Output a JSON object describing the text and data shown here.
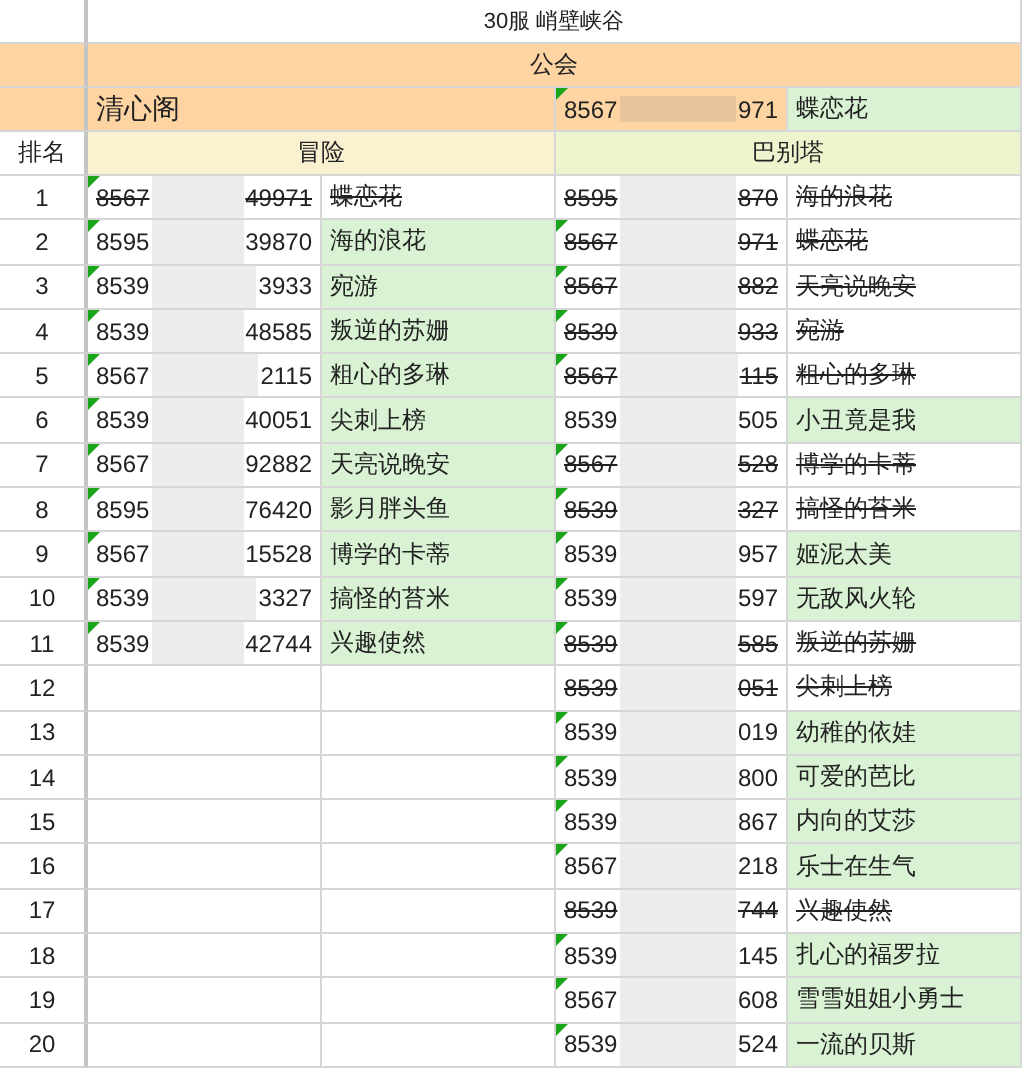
{
  "title": "30服 峭壁峡谷",
  "guild_label": "公会",
  "guild": {
    "name": "清心阁",
    "id_head": "8567",
    "id_tail": "971",
    "flag": true,
    "member": "蝶恋花",
    "struck": false
  },
  "rank_label": "排名",
  "groups": [
    "冒险",
    "巴别塔"
  ],
  "rows": [
    {
      "rank": "1",
      "left": {
        "id_head": "8567",
        "id_tail": "49971",
        "flag": true,
        "name": "蝶恋花",
        "struck": true
      },
      "right": {
        "id_head": "8595",
        "id_tail": "870",
        "flag": false,
        "name": "海的浪花",
        "struck": true
      }
    },
    {
      "rank": "2",
      "left": {
        "id_head": "8595",
        "id_tail": "39870",
        "flag": true,
        "name": "海的浪花",
        "struck": false
      },
      "right": {
        "id_head": "8567",
        "id_tail": "971",
        "flag": true,
        "name": "蝶恋花",
        "struck": true
      }
    },
    {
      "rank": "3",
      "left": {
        "id_head": "8539",
        "id_tail": "3933",
        "flag": true,
        "name": "宛游",
        "struck": false
      },
      "right": {
        "id_head": "8567",
        "id_tail": "882",
        "flag": true,
        "name": "天亮说晚安",
        "struck": true
      }
    },
    {
      "rank": "4",
      "left": {
        "id_head": "8539",
        "id_tail": "48585",
        "flag": true,
        "name": "叛逆的苏姗",
        "struck": false
      },
      "right": {
        "id_head": "8539",
        "id_tail": "933",
        "flag": true,
        "name": "宛游",
        "struck": true
      }
    },
    {
      "rank": "5",
      "left": {
        "id_head": "8567",
        "id_tail": "2115",
        "flag": true,
        "name": "粗心的多琳",
        "struck": false
      },
      "right": {
        "id_head": "8567",
        "id_tail": "115",
        "flag": true,
        "name": "粗心的多琳",
        "struck": true
      }
    },
    {
      "rank": "6",
      "left": {
        "id_head": "8539",
        "id_tail": "40051",
        "flag": true,
        "name": "尖刺上榜",
        "struck": false
      },
      "right": {
        "id_head": "8539",
        "id_tail": "505",
        "flag": false,
        "name": "小丑竟是我",
        "struck": false
      }
    },
    {
      "rank": "7",
      "left": {
        "id_head": "8567",
        "id_tail": "92882",
        "flag": true,
        "name": "天亮说晚安",
        "struck": false
      },
      "right": {
        "id_head": "8567",
        "id_tail": "528",
        "flag": true,
        "name": "博学的卡蒂",
        "struck": true
      }
    },
    {
      "rank": "8",
      "left": {
        "id_head": "8595",
        "id_tail": "76420",
        "flag": true,
        "name": "影月胖头鱼",
        "struck": false
      },
      "right": {
        "id_head": "8539",
        "id_tail": "327",
        "flag": true,
        "name": "搞怪的苔米",
        "struck": true
      }
    },
    {
      "rank": "9",
      "left": {
        "id_head": "8567",
        "id_tail": "15528",
        "flag": true,
        "name": "博学的卡蒂",
        "struck": false
      },
      "right": {
        "id_head": "8539",
        "id_tail": "957",
        "flag": true,
        "name": "姬泥太美",
        "struck": false
      }
    },
    {
      "rank": "10",
      "left": {
        "id_head": "8539",
        "id_tail": "3327",
        "flag": true,
        "name": "搞怪的苔米",
        "struck": false
      },
      "right": {
        "id_head": "8539",
        "id_tail": "597",
        "flag": true,
        "name": "无敌风火轮",
        "struck": false
      }
    },
    {
      "rank": "11",
      "left": {
        "id_head": "8539",
        "id_tail": "42744",
        "flag": true,
        "name": "兴趣使然",
        "struck": false
      },
      "right": {
        "id_head": "8539",
        "id_tail": "585",
        "flag": true,
        "name": "叛逆的苏姗",
        "struck": true
      }
    },
    {
      "rank": "12",
      "right": {
        "id_head": "8539",
        "id_tail": "051",
        "flag": false,
        "name": "尖刺上榜",
        "struck": true
      }
    },
    {
      "rank": "13",
      "right": {
        "id_head": "8539",
        "id_tail": "019",
        "flag": true,
        "name": "幼稚的依娃",
        "struck": false
      }
    },
    {
      "rank": "14",
      "right": {
        "id_head": "8539",
        "id_tail": "800",
        "flag": true,
        "name": "可爱的芭比",
        "struck": false
      }
    },
    {
      "rank": "15",
      "right": {
        "id_head": "8539",
        "id_tail": "867",
        "flag": true,
        "name": "内向的艾莎",
        "struck": false
      }
    },
    {
      "rank": "16",
      "right": {
        "id_head": "8567",
        "id_tail": "218",
        "flag": true,
        "name": "乐士在生气",
        "struck": false
      }
    },
    {
      "rank": "17",
      "right": {
        "id_head": "8539",
        "id_tail": "744",
        "flag": false,
        "name": "兴趣使然",
        "struck": true
      }
    },
    {
      "rank": "18",
      "right": {
        "id_head": "8539",
        "id_tail": "145",
        "flag": true,
        "name": "扎心的福罗拉",
        "struck": false
      }
    },
    {
      "rank": "19",
      "right": {
        "id_head": "8567",
        "id_tail": "608",
        "flag": true,
        "name": "雪雪姐姐小勇士",
        "struck": false
      }
    },
    {
      "rank": "20",
      "right": {
        "id_head": "8539",
        "id_tail": "524",
        "flag": true,
        "name": "一流的贝斯",
        "struck": false
      }
    }
  ]
}
